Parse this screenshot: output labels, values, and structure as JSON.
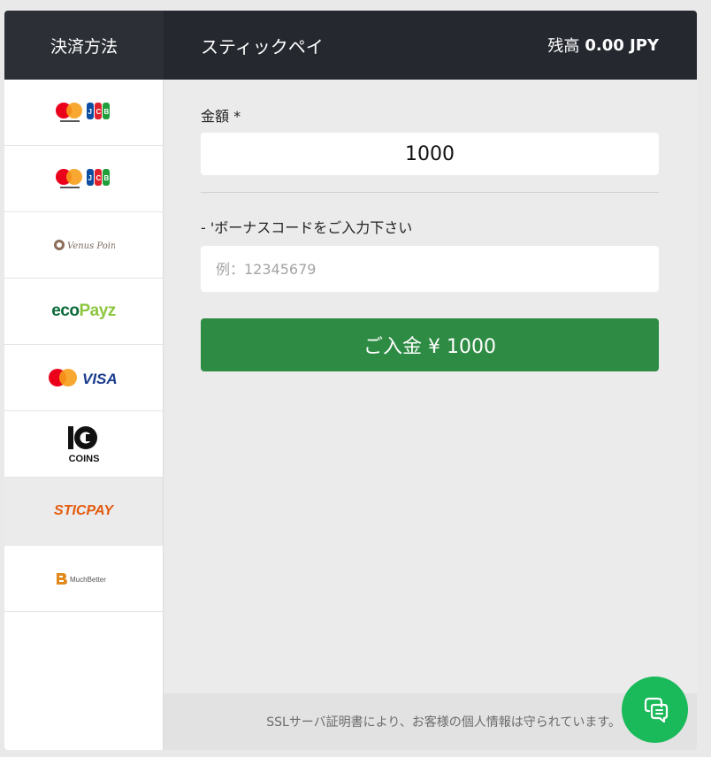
{
  "header": {
    "sidebar_title": "決済方法",
    "method_title": "スティックペイ",
    "balance_label": "残高",
    "balance_value": "0.00 JPY"
  },
  "sidebar": {
    "items": [
      {
        "name": "mastercard-jcb"
      },
      {
        "name": "mastercard-jcb"
      },
      {
        "name": "venus-point",
        "logo_text": "Venus Point"
      },
      {
        "name": "ecopayz",
        "logo_text_1": "eco",
        "logo_text_2": "Payz"
      },
      {
        "name": "mastercard-visa",
        "logo_text": "VISA"
      },
      {
        "name": "10-coins",
        "logo_text": "COINS"
      },
      {
        "name": "sticpay",
        "logo_text": "STICPAY",
        "active": true
      },
      {
        "name": "muchbetter",
        "logo_text": "MuchBetter"
      }
    ]
  },
  "form": {
    "amount_label": "金額 *",
    "amount_value": "1000",
    "bonus_label": "- 'ボーナスコードをご入力下さい",
    "bonus_placeholder": "例：12345679",
    "deposit_button": "ご入金 ¥ 1000"
  },
  "footer": {
    "ssl_text": "SSLサーバ証明書により、お客様の個人情報は守られています。"
  },
  "colors": {
    "header_bg": "#25282f",
    "deposit_green": "#2e8b44",
    "chat_green": "#1ab95a"
  },
  "icons": {
    "chat": "chat-bubbles-icon"
  }
}
